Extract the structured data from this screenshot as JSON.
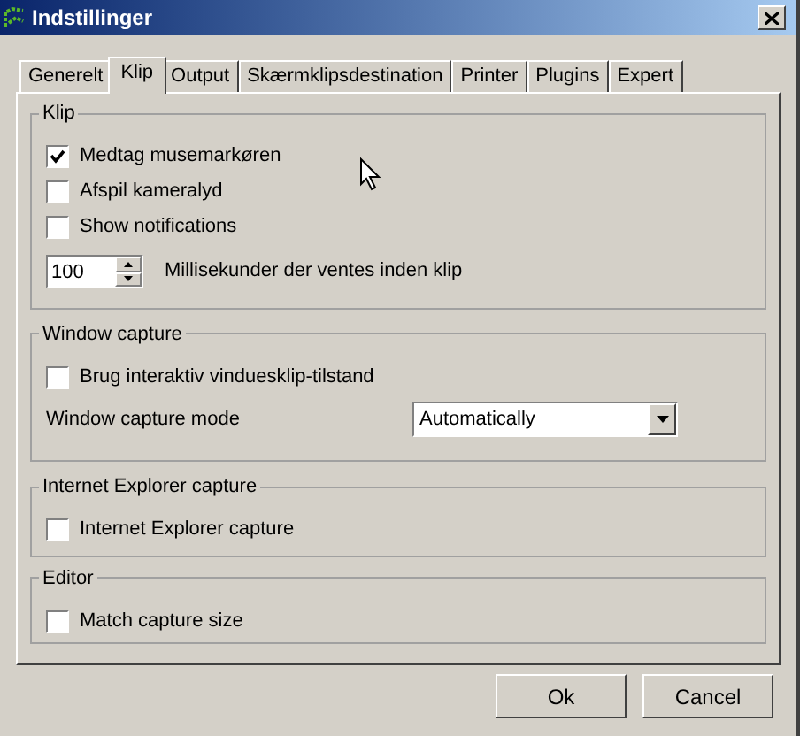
{
  "window": {
    "title": "Indstillinger"
  },
  "tabs": [
    {
      "label": "Generelt",
      "selected": false
    },
    {
      "label": "Klip",
      "selected": true
    },
    {
      "label": "Output",
      "selected": false
    },
    {
      "label": "Skærmklipsdestination",
      "selected": false
    },
    {
      "label": "Printer",
      "selected": false
    },
    {
      "label": "Plugins",
      "selected": false
    },
    {
      "label": "Expert",
      "selected": false
    }
  ],
  "groups": [
    {
      "title": "Klip",
      "items": [
        {
          "kind": "checkbox",
          "label": "Medtag musemarkøren",
          "checked": true
        },
        {
          "kind": "checkbox",
          "label": "Afspil kameralyd",
          "checked": false
        },
        {
          "kind": "checkbox",
          "label": "Show notifications",
          "checked": false
        },
        {
          "kind": "spinner",
          "value": "100",
          "caption": "Millisekunder der ventes inden klip"
        }
      ]
    },
    {
      "title": "Window capture",
      "items": [
        {
          "kind": "checkbox",
          "label": "Brug interaktiv vinduesklip-tilstand",
          "checked": false
        },
        {
          "kind": "dropdown",
          "label": "Window capture mode",
          "value": "Automatically"
        }
      ]
    },
    {
      "title": "Internet Explorer capture",
      "items": [
        {
          "kind": "checkbox",
          "label": "Internet Explorer capture",
          "checked": false
        }
      ]
    },
    {
      "title": "Editor",
      "items": [
        {
          "kind": "checkbox",
          "label": "Match capture size",
          "checked": false
        }
      ]
    }
  ],
  "buttons": [
    "Ok",
    "Cancel"
  ]
}
